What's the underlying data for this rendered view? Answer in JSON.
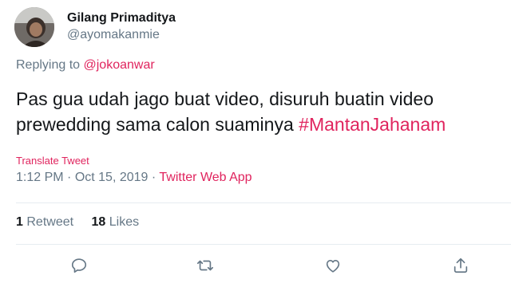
{
  "author": {
    "name": "Gilang Primaditya",
    "handle": "@ayomakanmie"
  },
  "reply": {
    "prefix": "Replying to",
    "to": "@jokoanwar"
  },
  "tweet": {
    "text": "Pas gua udah jago buat video, disuruh buatin video prewedding sama calon suaminya",
    "hashtag": "#MantanJahanam"
  },
  "translate_label": "Translate Tweet",
  "meta": {
    "time": "1:12 PM",
    "sep1": " · ",
    "date": "Oct 15, 2019",
    "sep2": " · ",
    "app": "Twitter Web App"
  },
  "stats": {
    "retweets_count": "1",
    "retweets_label": "Retweet",
    "likes_count": "18",
    "likes_label": "Likes"
  },
  "actions": [
    {
      "name": "reply-icon"
    },
    {
      "name": "retweet-icon"
    },
    {
      "name": "like-icon"
    },
    {
      "name": "share-icon"
    }
  ],
  "colors": {
    "accent": "#e0245e",
    "secondary_text": "#657786",
    "primary_text": "#14171a"
  }
}
